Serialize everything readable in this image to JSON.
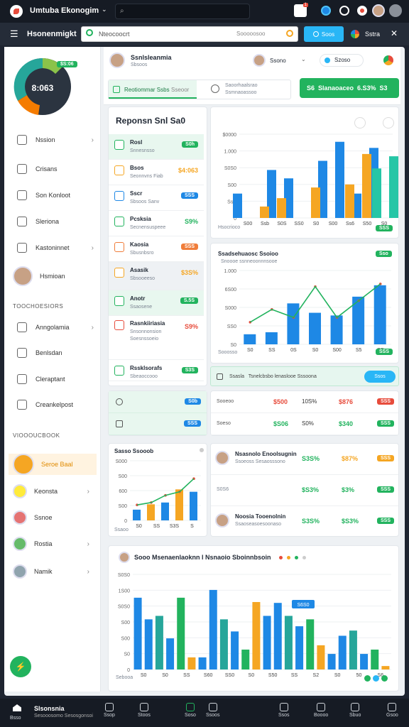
{
  "app": {
    "title": "Umtuba Ekonogim",
    "search_placeholder": "",
    "notif_badge": "1"
  },
  "nav": {
    "title": "Hsonenmigkt",
    "search_value": "Nteocoocrt",
    "search_hint": "Sooooosoo",
    "btn1": "Soos",
    "btn2": "Sstra"
  },
  "colors": {
    "accent": "#22b35e",
    "blue": "#1e88e5",
    "orange": "#f5a623",
    "teal": "#26c6da",
    "green": "#2ecc71",
    "red": "#e74c3c"
  },
  "sidebar": {
    "donut_value": "8:063",
    "donut_badge": "$S:06",
    "items": [
      {
        "label": "Nssion",
        "icon": "cube-icon"
      },
      {
        "label": "Crisans",
        "icon": "folder-icon"
      },
      {
        "label": "Son Konloot",
        "icon": "plus-icon"
      },
      {
        "label": "Sleriona",
        "icon": "home-icon"
      },
      {
        "label": "Kastoninnet",
        "icon": "grid-icon"
      },
      {
        "label": "Hsmioan",
        "icon": "user-icon"
      }
    ],
    "section1": "TOOCHOESIORS",
    "items2": [
      {
        "label": "Anngolamia",
        "icon": "circle-icon"
      },
      {
        "label": "Benlsdan",
        "icon": "doc-icon"
      },
      {
        "label": "Cleraptant",
        "icon": "calendar-icon"
      },
      {
        "label": "Creankelpost",
        "icon": "list-icon"
      }
    ],
    "section2": "VIOOOUCBOOK",
    "people": [
      {
        "label": "Seroe Baal"
      },
      {
        "label": "Keonsta"
      },
      {
        "label": "Ssnoe"
      },
      {
        "label": "Rostia"
      },
      {
        "label": "Namik"
      }
    ]
  },
  "header": {
    "user_name": "Ssnlsleanmia",
    "user_sub": "Sbsoos",
    "user2": "Ssono",
    "chip": "Szoso",
    "tab1": "Reotiommar Ssbs",
    "tab2": "Sseoor",
    "tab3_a": "Saoorhaalsrao",
    "tab3_b": "Ssmnaoassoo",
    "cta": "S6  Slanaoaceo  6.S3%  S3"
  },
  "report": {
    "title": "Reponsn Snl Sa0",
    "list": [
      {
        "name": "Rosl",
        "sub": "Snnesnsso",
        "badge": "S0h",
        "bcolor": "#22b35e"
      },
      {
        "name": "Bsos",
        "sub": "Seonnvns Fiab",
        "badge": "$4:063",
        "bcolor": "#f5a623",
        "text": true
      },
      {
        "name": "Sscr",
        "sub": "Sbsoos Sanv",
        "badge": "SSS",
        "bcolor": "#1e88e5"
      },
      {
        "name": "Pcsksia",
        "sub": "Secnensuspeee",
        "badge": "S9%",
        "bcolor": "#22b35e",
        "text": true
      },
      {
        "name": "Kaosia",
        "sub": "Sbusnbsro",
        "badge": "SSS",
        "bcolor": "#f07d3a"
      },
      {
        "name": "Asasik",
        "sub": "Sbsooeeso",
        "badge": "$3S%",
        "bcolor": "#f5a623",
        "text": true
      },
      {
        "name": "Anotr",
        "sub": "Ssaosene",
        "badge": "S.5S",
        "bcolor": "#22b35e"
      },
      {
        "name": "Rasnkiiriasia",
        "sub": "Snsonnonsion\nSoesnssoeio",
        "badge": "S9%",
        "bcolor": "#e74c3c",
        "text": true
      },
      {
        "name": "Rssklsorafs",
        "sub": "Sbeaoccooo",
        "badge": "S3S",
        "bcolor": "#22b35e"
      }
    ],
    "mini_rows": [
      {
        "badge": "S0b"
      },
      {
        "badge": "SSS"
      }
    ]
  },
  "chart1": {
    "badge": "SSS",
    "foot": "Hsocrioco",
    "corner": "SSS"
  },
  "chart2": {
    "title": "Ssadsehuaosc Ssoioo",
    "sub": "Snoooe ssnneoonnnsooe",
    "badge": "Sso",
    "foot": "Sooosso",
    "corner": "SSS"
  },
  "bar_strip": {
    "text": "Ssasla   Tsnelcbsbo lenaslooe Sssoona",
    "btn": "Ssos"
  },
  "stats": [
    {
      "a": "Sooeoo",
      "b": "$500",
      "c": "10S%",
      "d": "$876",
      "badge": "SSS",
      "bcolor": "#e74c3c",
      "bcol": "#e74c3c"
    },
    {
      "a": "Soeso",
      "b": "$S06",
      "c": "S0%",
      "d": "$340",
      "badge": "SSS",
      "bcolor": "#22b35e",
      "bcol": "#22b35e"
    }
  ],
  "chart3": {
    "title": "Sasso Ssooob",
    "foot": "Ssaoo"
  },
  "people_stats": [
    {
      "name": "Nsasnolo Enoolsugnin",
      "sub": "Ssoeoss Sesaosssono",
      "v1": "S3S%",
      "v2": "$87%",
      "badge": "SSS",
      "bcolor": "#f5a623"
    },
    {
      "name": "",
      "sub": "S0S6",
      "v1": "$S3%",
      "v2": "$3%",
      "badge": "SSS",
      "bcolor": "#22b35e"
    },
    {
      "name": "Noosia Tooenolnin",
      "sub": "Ssaoseasoesoonaso",
      "v1": "S3S%",
      "v2": "$S3%",
      "badge": "SSS",
      "bcolor": "#22b35e"
    }
  ],
  "chart4": {
    "title": "Sooo Msenaenlaoknn l Nsnaoio Sboinnbsoin",
    "foot": "Sebooa",
    "callout": "S6S0"
  },
  "chart_data": [
    {
      "type": "bar",
      "categories": [
        "S00",
        "Ssb",
        "S0S",
        "SS0",
        "S0",
        "S00",
        "Ss6",
        "S50",
        "S0"
      ],
      "series": [
        {
          "name": "",
          "values": [
            320,
            0,
            630,
            520,
            0,
            750,
            1000,
            320,
            920
          ]
        },
        {
          "name": "",
          "values": [
            0,
            150,
            260,
            0,
            400,
            0,
            440,
            840,
            0
          ]
        },
        {
          "name": "",
          "values": [
            0,
            0,
            0,
            0,
            0,
            0,
            0,
            650,
            810
          ]
        }
      ],
      "ylabels": [
        "$0000",
        "1.000",
        "S0S0",
        "S00",
        "SsS",
        "0"
      ],
      "ylim": [
        0,
        1100
      ]
    },
    {
      "type": "bar",
      "categories": [
        "S0",
        "SS",
        "0S",
        "S0",
        "S00",
        "S5",
        "SS"
      ],
      "values": [
        150,
        180,
        610,
        470,
        430,
        710,
        880
      ],
      "line": [
        330,
        520,
        400,
        860,
        400,
        650,
        900
      ],
      "ylabels": [
        "1.000",
        "6S00",
        "S000",
        "SS0",
        "S0"
      ],
      "ylim": [
        0,
        1100
      ]
    },
    {
      "type": "bar",
      "categories": [
        "S0",
        "SS",
        "S3S",
        "S"
      ],
      "values": [
        180,
        270,
        300,
        520,
        480
      ],
      "ylabels": [
        "S000",
        "S00",
        "600",
        "S00",
        "0"
      ],
      "ylim": [
        0,
        1000
      ]
    },
    {
      "type": "bar",
      "categories": [
        "S0",
        "S0",
        "SS",
        "S60",
        "SS0",
        "S0",
        "S50",
        "SS",
        "S2",
        "S0",
        "50",
        "S6"
      ],
      "values": [
        830,
        580,
        620,
        360,
        830,
        140,
        140,
        920,
        580,
        440,
        230,
        780,
        620,
        770,
        620,
        500,
        580,
        280,
        180,
        390,
        450,
        180,
        230,
        40
      ],
      "ylabels": [
        "S0S0",
        "1S00",
        "S0S0",
        "S00",
        "S00",
        "S0",
        "0"
      ],
      "ylim": [
        0,
        1100
      ]
    }
  ],
  "bottom": {
    "t1": "Slsonsnia",
    "t1b": "Sesooosomo Sesosgonsoi",
    "items": [
      "Bsso",
      "Ssop",
      "Stoos",
      "Soso",
      "Ssoos",
      "Ssos",
      "Boooo",
      "Sbuo",
      "Gsoo"
    ]
  }
}
